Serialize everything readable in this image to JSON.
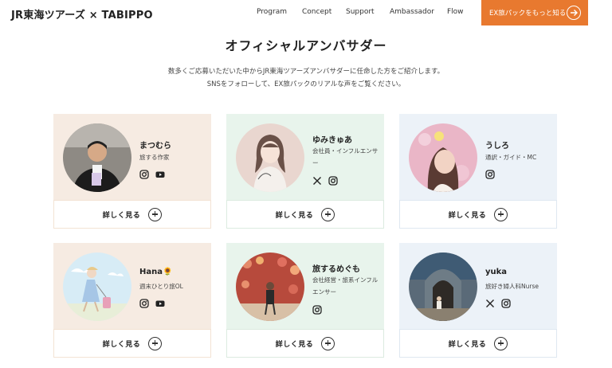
{
  "header": {
    "logo": "JR東海ツアーズ × TABIPPO",
    "nav": [
      "Program",
      "Concept",
      "Support",
      "Ambassador",
      "Flow"
    ],
    "cta_label": "EX旅パックをもっと知る"
  },
  "section": {
    "title": "オフィシャルアンバサダー",
    "intro_line1": "数多くご応募いただいた中からJR東海ツアーズアンバサダーに任命した方をご紹介します。",
    "intro_line2": "SNSをフォローして、EX旅パックのリアルな声をご覧ください。"
  },
  "detail_label": "詳しく見る",
  "colors": {
    "accent": "#e8792f",
    "card_beige": "#f6ebe2",
    "card_green": "#e8f4ec",
    "card_blue": "#ecf2f8",
    "icon_dark": "#222222"
  },
  "ambassadors": [
    {
      "name": "まつむら",
      "role": "旅する作家",
      "socials": [
        "instagram-icon",
        "youtube-icon"
      ]
    },
    {
      "name": "ゆみきゅあ",
      "role": "会社員・インフルエンサー",
      "socials": [
        "x-icon",
        "instagram-icon"
      ]
    },
    {
      "name": "うしろ",
      "role": "通訳・ガイド・MC",
      "socials": [
        "instagram-icon"
      ]
    },
    {
      "name": "Hana🌻",
      "role": "週末ひとり旅OL",
      "socials": [
        "instagram-icon",
        "youtube-icon"
      ]
    },
    {
      "name": "旅するめぐも",
      "role": "会社経営・旅系インフルエンサー",
      "socials": [
        "instagram-icon"
      ]
    },
    {
      "name": "yuka",
      "role": "旅好き婦人科Nurse",
      "socials": [
        "x-icon",
        "instagram-icon"
      ]
    }
  ]
}
